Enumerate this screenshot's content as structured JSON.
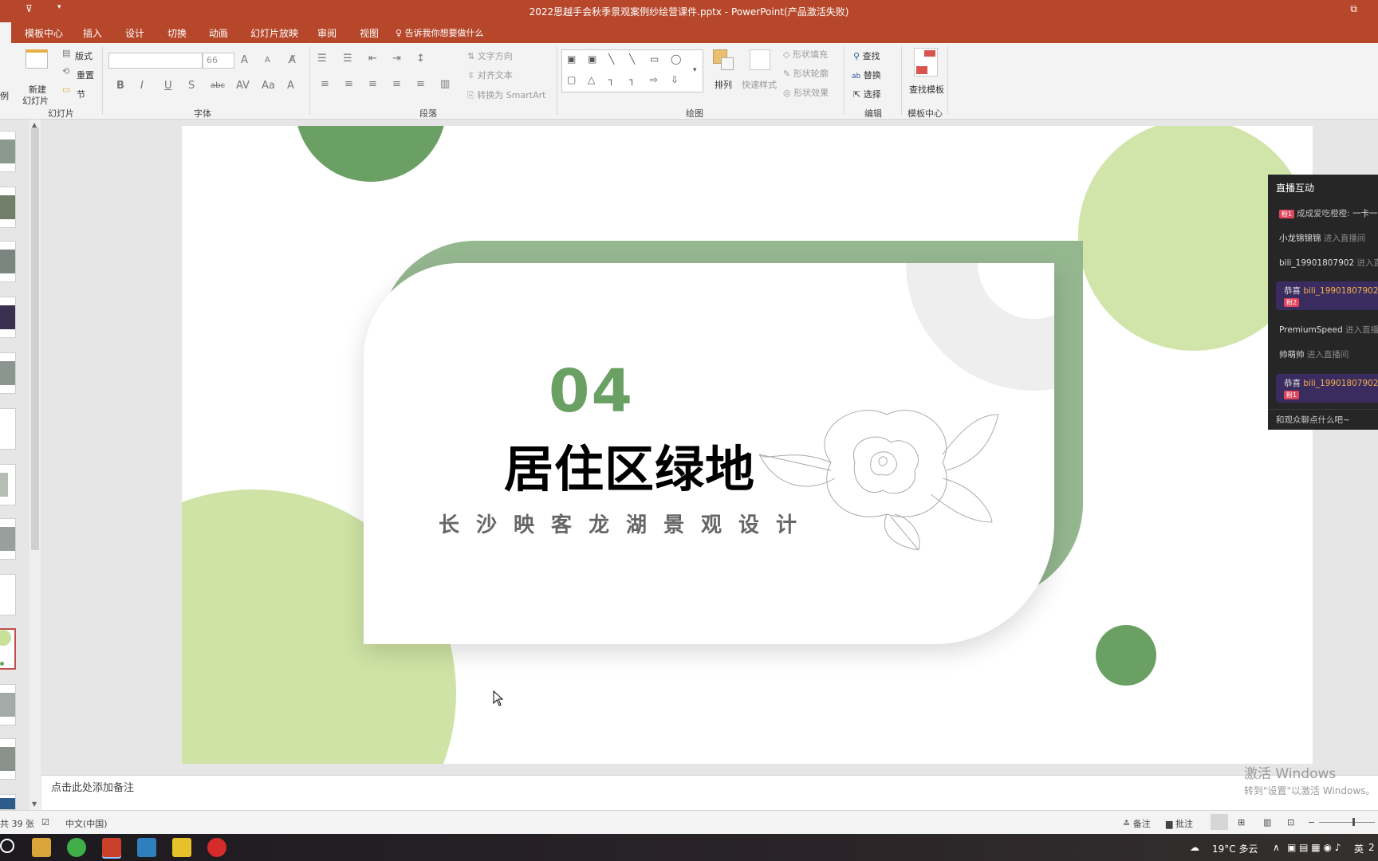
{
  "titlebar": {
    "title": "2022思越手会秋季景观案例纱绘营课件.pptx - PowerPoint(产品激活失败)"
  },
  "menu": {
    "tabs": [
      "模板中心",
      "插入",
      "设计",
      "切换",
      "动画",
      "幻灯片放映",
      "审阅",
      "视图"
    ],
    "tell_me": "告诉我你想要做什么"
  },
  "ribbon": {
    "slides": {
      "new_slide": "新建",
      "new_slide2": "幻灯片",
      "layout": "版式",
      "reset": "重置",
      "section": "节",
      "label": "幻灯片",
      "left_cut": "例"
    },
    "font": {
      "font_name": "",
      "font_size": "66",
      "label": "字体"
    },
    "paragraph": {
      "text_direction": "文字方向",
      "align_text": "对齐文本",
      "convert_smartart": "转换为 SmartArt",
      "label": "段落"
    },
    "drawing": {
      "arrange": "排列",
      "quick_styles": "快速样式",
      "shape_fill": "形状填充",
      "shape_outline": "形状轮廓",
      "shape_effects": "形状效果",
      "label": "绘图"
    },
    "editing": {
      "find": "查找",
      "replace": "替换",
      "select": "选择",
      "label": "编辑"
    },
    "template": {
      "find_template": "查找模板",
      "label": "模板中心"
    }
  },
  "slide": {
    "number": "04",
    "title": "居住区绿地",
    "subtitle": "长沙映客龙湖景观设计"
  },
  "notes": {
    "placeholder": "点击此处添加备注"
  },
  "status": {
    "slide_count": "共 39 张",
    "language": "中文(中国)",
    "notes_btn": "备注",
    "comments_btn": "批注"
  },
  "live": {
    "title": "直播互动",
    "messages": [
      {
        "badge": "粉1",
        "user": "成成爱吃橙橙:",
        "text": "一卡一"
      },
      {
        "user": "小龙锦锦锦",
        "text": "进入直播间"
      },
      {
        "user": "bili_19901807902",
        "text": "进入直"
      },
      {
        "prefix": "恭喜",
        "user": "bili_19901807902",
        "badge": "粉2"
      },
      {
        "user": "PremiumSpeed",
        "text": "进入直播"
      },
      {
        "user": "帅萌帅",
        "text": "进入直播间"
      },
      {
        "prefix": "恭喜",
        "user": "bili_19901807902",
        "badge": "粉1"
      }
    ],
    "input_placeholder": "和观众聊点什么吧~"
  },
  "watermark": {
    "line1": "激活 Windows",
    "line2": "转到\"设置\"以激活 Windows。"
  },
  "taskbar": {
    "weather": "19°C 多云",
    "ime": "英",
    "time_cut": "2"
  },
  "colors": {
    "title_bar": "#b7472a",
    "accent_green": "#6aa063",
    "light_green": "#c9e09b",
    "dark_green_frame": "#8fb38a"
  }
}
